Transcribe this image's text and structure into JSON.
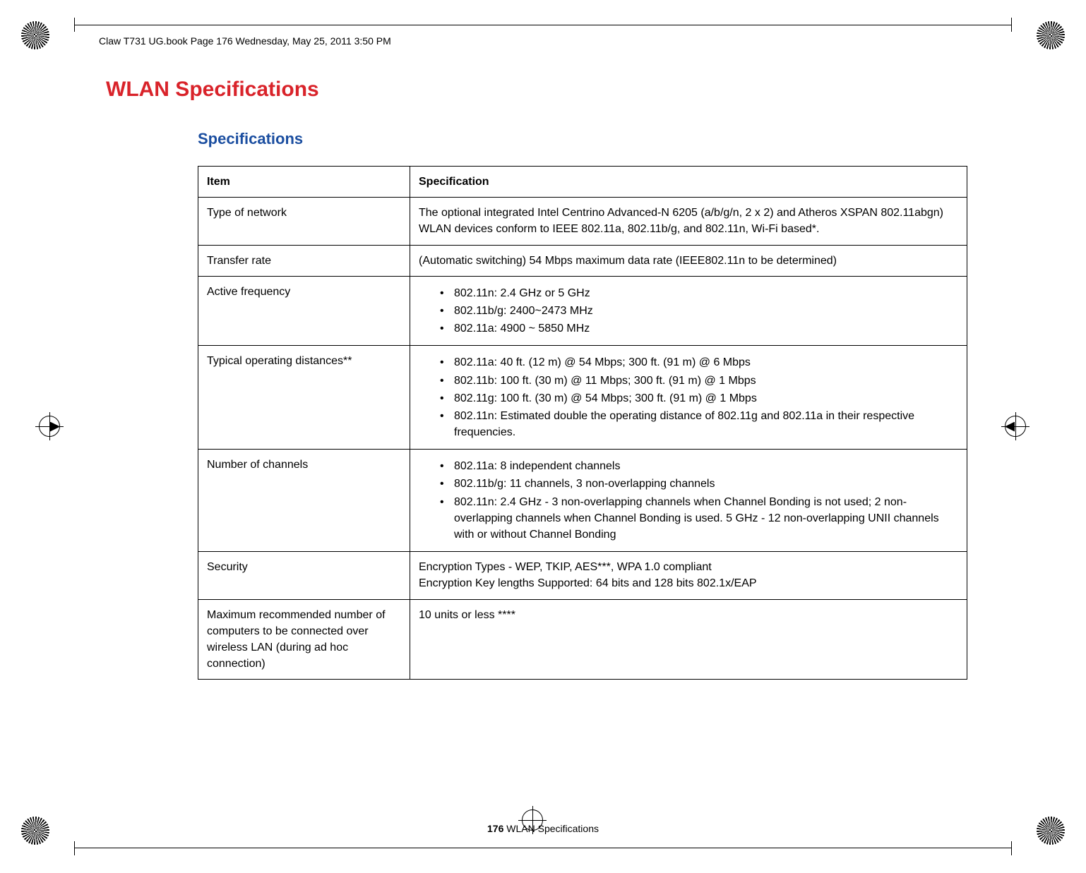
{
  "running_head": "Claw T731 UG.book  Page 176  Wednesday, May 25, 2011  3:50 PM",
  "title": "WLAN Specifications",
  "subtitle": "Specifications",
  "table": {
    "header": {
      "item": "Item",
      "spec": "Specification"
    },
    "rows": {
      "type_of_network": {
        "item": "Type of network",
        "spec": "The optional integrated Intel Centrino Advanced-N 6205 (a/b/g/n, 2 x 2) and Atheros XSPAN 802.11abgn) WLAN devices conform to IEEE 802.11a, 802.11b/g, and 802.11n, Wi-Fi based*."
      },
      "transfer_rate": {
        "item": "Transfer rate",
        "spec": "(Automatic switching) 54 Mbps maximum data rate (IEEE802.11n to be determined)"
      },
      "active_frequency": {
        "item": "Active frequency",
        "bullets": [
          "802.11n: 2.4 GHz or 5 GHz",
          "802.11b/g: 2400~2473 MHz",
          "802.11a: 4900 ~ 5850 MHz"
        ]
      },
      "typical_distances": {
        "item": "Typical operating distances**",
        "bullets": [
          "802.11a: 40 ft. (12 m) @ 54 Mbps; 300 ft. (91 m) @ 6 Mbps",
          "802.11b: 100 ft. (30 m) @ 11 Mbps; 300 ft. (91 m) @ 1 Mbps",
          "802.11g: 100 ft. (30 m) @ 54 Mbps; 300 ft. (91 m) @ 1 Mbps",
          "802.11n: Estimated double the operating distance of 802.11g and 802.11a in their respective frequencies."
        ]
      },
      "num_channels": {
        "item": "Number of channels",
        "bullets": [
          "802.11a: 8 independent channels",
          "802.11b/g: 11 channels, 3 non-overlapping channels",
          "802.11n: 2.4 GHz - 3 non-overlapping channels when Channel Bonding is not used; 2 non-overlapping channels when Channel Bonding is used. 5 GHz - 12 non-overlapping UNII channels with or without Channel Bonding"
        ]
      },
      "security": {
        "item": "Security",
        "spec_l1": "Encryption Types - WEP, TKIP, AES***, WPA 1.0 compliant",
        "spec_l2": "Encryption Key lengths Supported: 64 bits and 128 bits 802.1x/EAP"
      },
      "max_recommended": {
        "item": "Maximum recommended number of computers to be connected over wireless LAN (during ad hoc connection)",
        "spec": "10 units or less ****"
      }
    }
  },
  "footer": {
    "page_number": "176",
    "label": " WLAN Specifications"
  }
}
